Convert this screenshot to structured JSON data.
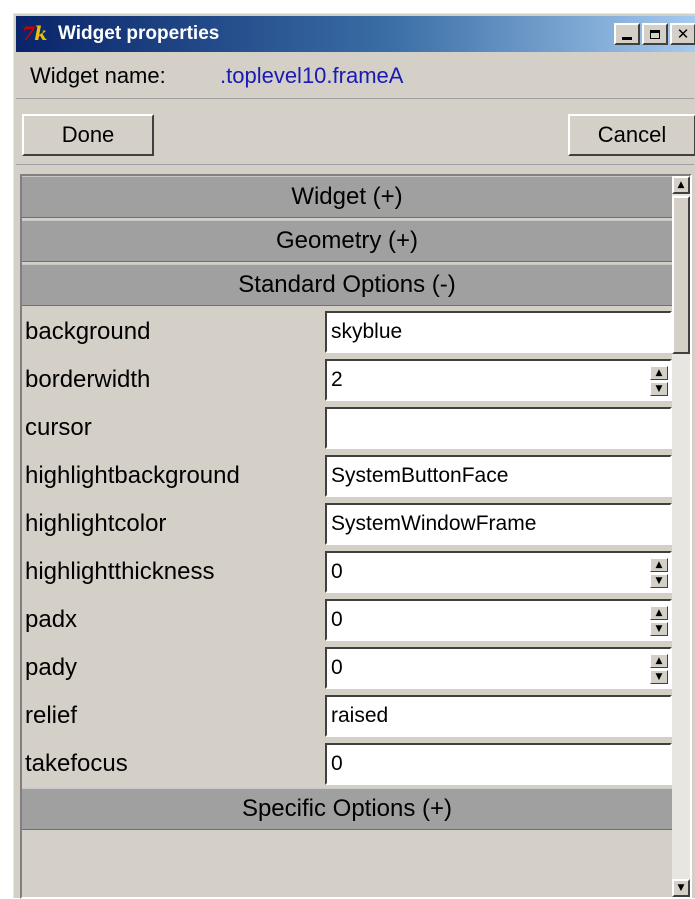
{
  "window": {
    "title": "Widget properties",
    "app_icon": "tk-logo-icon",
    "caption_buttons": [
      "minimize-icon",
      "maximize-icon",
      "close-icon"
    ]
  },
  "widget_name": {
    "label": "Widget name:",
    "value": ".toplevel10.frameA"
  },
  "buttons": {
    "done": "Done",
    "cancel": "Cancel"
  },
  "sections": {
    "widget": "Widget (+)",
    "geometry": "Geometry (+)",
    "standard": "Standard Options (-)",
    "specific": "Specific Options (+)"
  },
  "properties": [
    {
      "name": "background",
      "value": "skyblue",
      "spinbox": false
    },
    {
      "name": "borderwidth",
      "value": "2",
      "spinbox": true
    },
    {
      "name": "cursor",
      "value": "",
      "spinbox": false
    },
    {
      "name": "highlightbackground",
      "value": "SystemButtonFace",
      "spinbox": false
    },
    {
      "name": "highlightcolor",
      "value": "SystemWindowFrame",
      "spinbox": false
    },
    {
      "name": "highlightthickness",
      "value": "0",
      "spinbox": true
    },
    {
      "name": "padx",
      "value": "0",
      "spinbox": true
    },
    {
      "name": "pady",
      "value": "0",
      "spinbox": true
    },
    {
      "name": "relief",
      "value": "raised",
      "spinbox": false
    },
    {
      "name": "takefocus",
      "value": "0",
      "spinbox": false
    }
  ],
  "colors": {
    "titlebar_start": "#0a246a",
    "titlebar_end": "#a6caf0",
    "widget_name_value": "#1a1ab4",
    "face": "#d4d0c8",
    "section_header": "#a0a0a0"
  }
}
